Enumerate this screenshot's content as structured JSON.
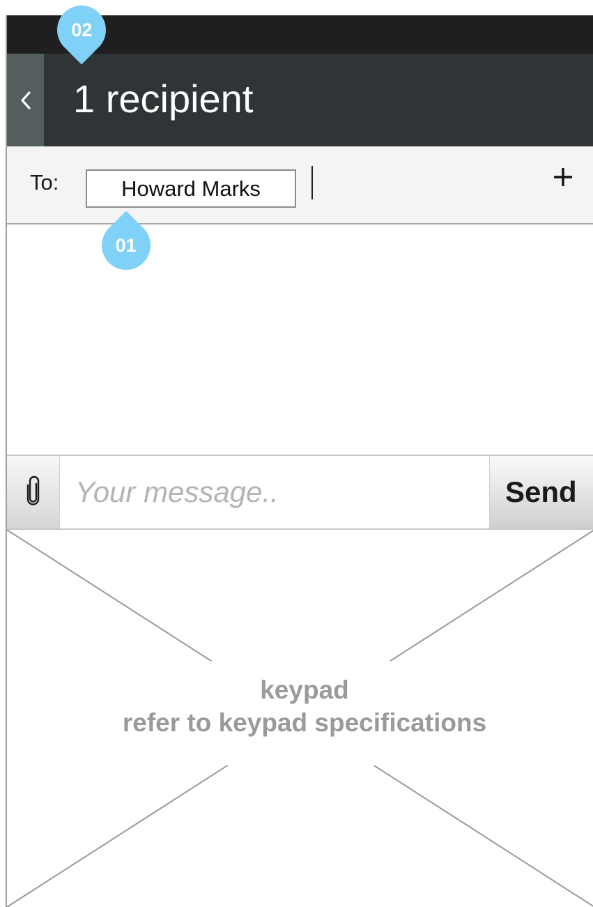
{
  "header": {
    "back_icon": "chevron-left-icon",
    "title": "1 recipient"
  },
  "recipients": {
    "to_label": "To:",
    "chips": [
      "Howard Marks"
    ],
    "add_icon": "plus-icon"
  },
  "compose": {
    "attach_icon": "paperclip-icon",
    "placeholder": "Your message..",
    "value": "",
    "send_label": "Send"
  },
  "keypad": {
    "title": "keypad",
    "note": "refer to keypad specifications"
  },
  "annotations": [
    {
      "label": "02"
    },
    {
      "label": "01"
    }
  ],
  "colors": {
    "status_bar": "#1f1f1f",
    "header_bg": "#2f3537",
    "back_button_bg": "#545e5e",
    "marker": "#7fd1f7",
    "to_row_bg": "#f4f4f4",
    "placeholder_text": "#b4b4b4",
    "keypad_text": "#9a9a9a"
  }
}
